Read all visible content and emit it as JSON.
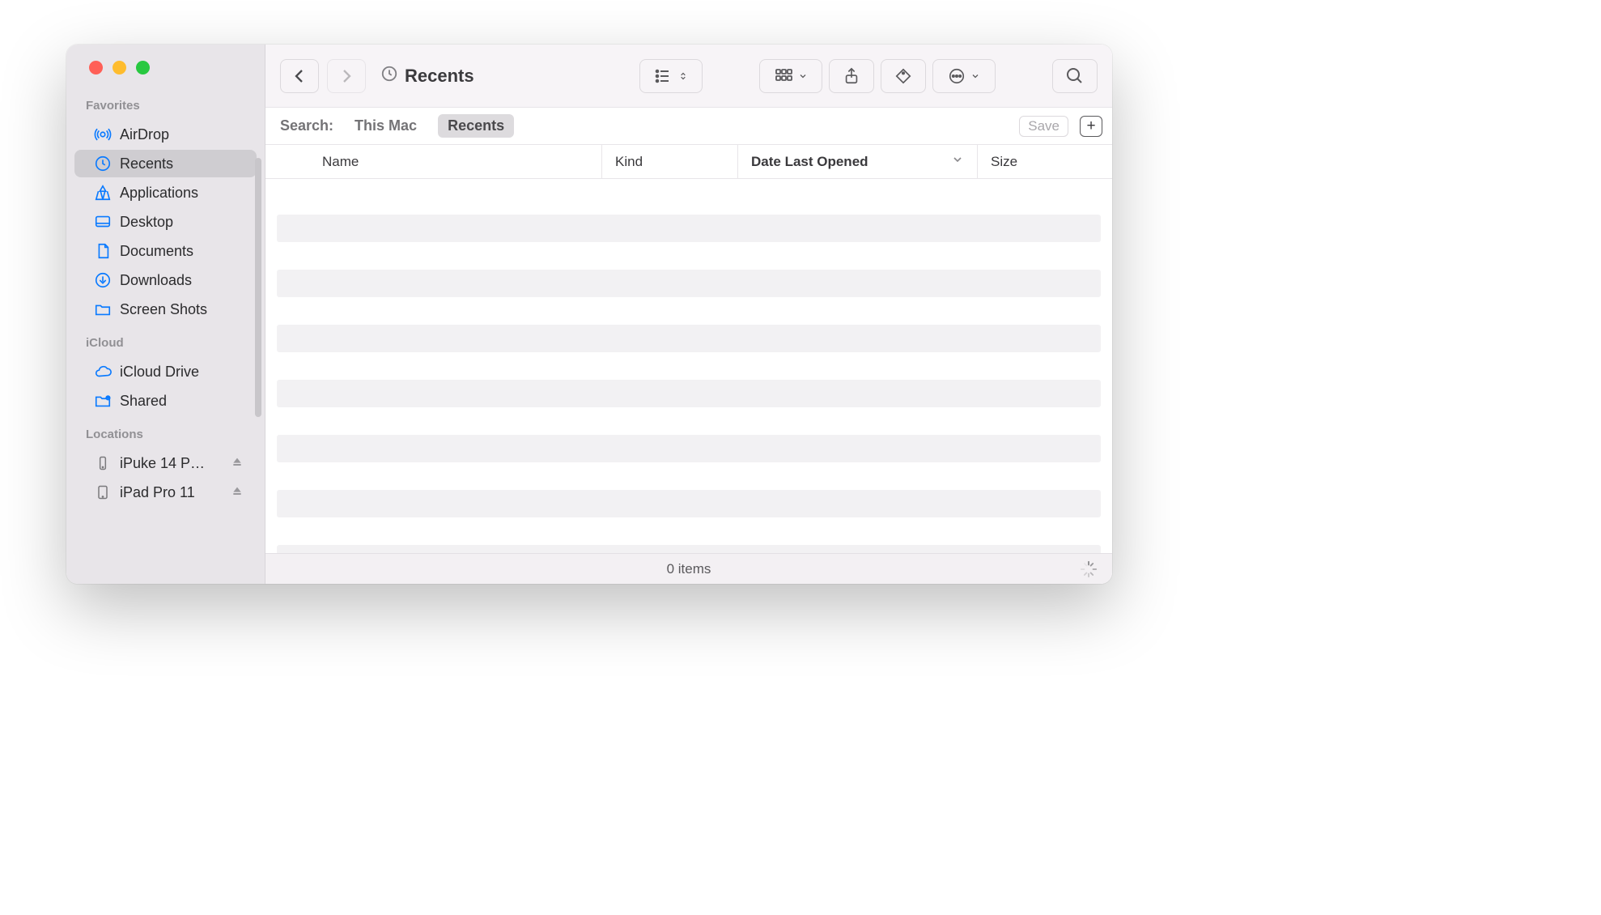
{
  "window": {
    "title": "Recents"
  },
  "sidebar": {
    "sections": {
      "favorites": {
        "label": "Favorites",
        "items": [
          {
            "label": "AirDrop"
          },
          {
            "label": "Recents"
          },
          {
            "label": "Applications"
          },
          {
            "label": "Desktop"
          },
          {
            "label": "Documents"
          },
          {
            "label": "Downloads"
          },
          {
            "label": "Screen Shots"
          }
        ]
      },
      "icloud": {
        "label": "iCloud",
        "items": [
          {
            "label": "iCloud Drive"
          },
          {
            "label": "Shared"
          }
        ]
      },
      "locations": {
        "label": "Locations",
        "items": [
          {
            "label": "iPuke 14 P…"
          },
          {
            "label": "iPad Pro 11"
          }
        ]
      }
    }
  },
  "search": {
    "label": "Search:",
    "scopes": {
      "thismac": "This Mac",
      "recents": "Recents"
    },
    "save": "Save",
    "plus": "+"
  },
  "columns": {
    "name": "Name",
    "kind": "Kind",
    "date": "Date Last Opened",
    "size": "Size"
  },
  "status": {
    "items_text": "0 items"
  }
}
